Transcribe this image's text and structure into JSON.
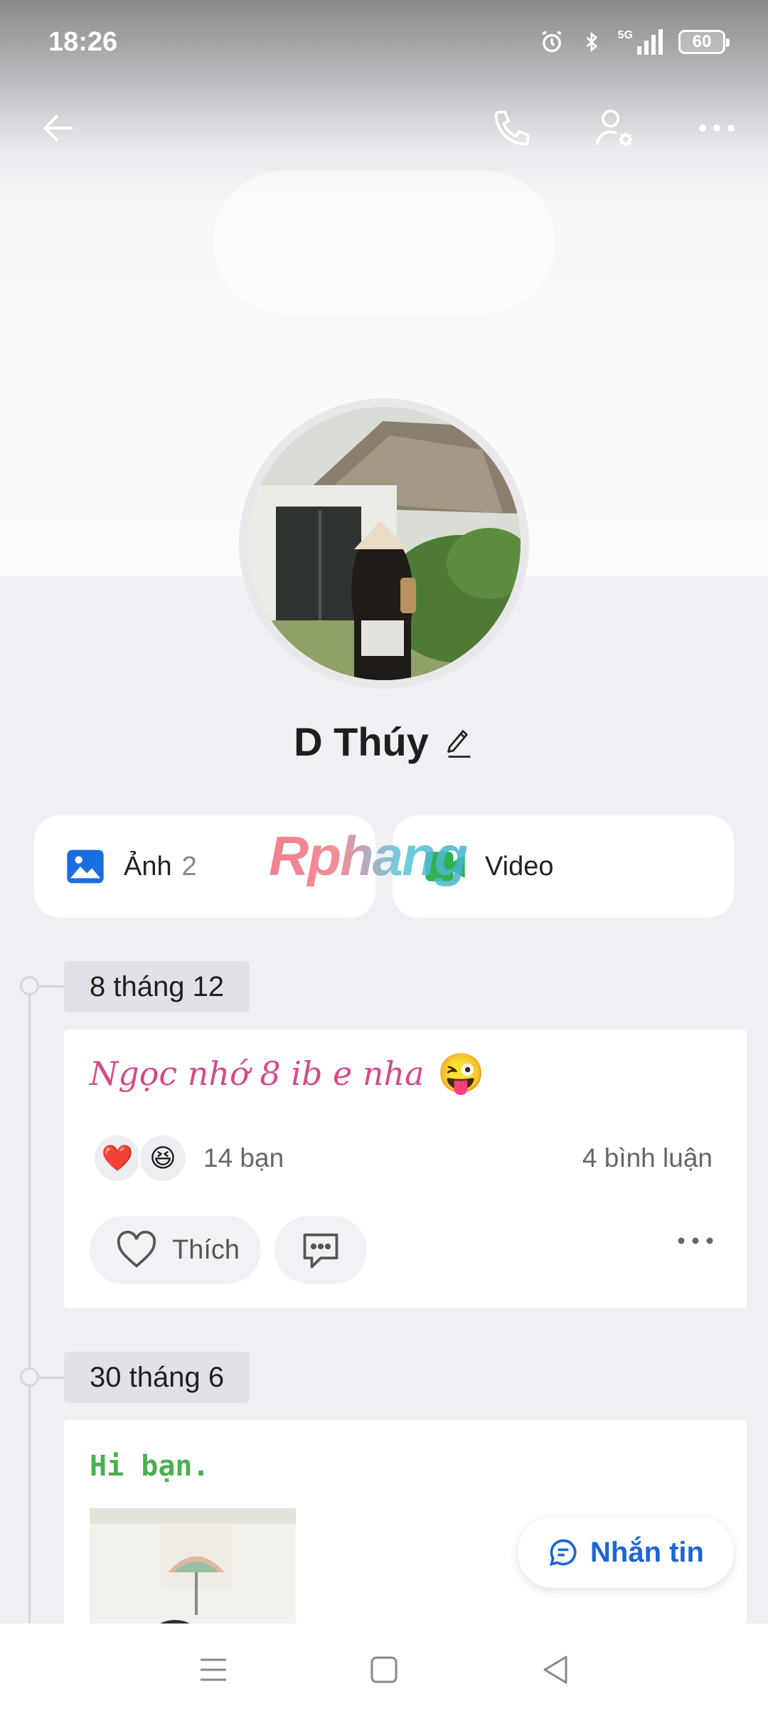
{
  "status_bar": {
    "time": "18:26",
    "network": "5G",
    "battery": "60"
  },
  "profile": {
    "name": "D Thúy"
  },
  "media": {
    "photos": {
      "label": "Ảnh",
      "count": "2"
    },
    "videos": {
      "label": "Video"
    }
  },
  "watermark": "Rphang",
  "posts": [
    {
      "date": "8 tháng 12",
      "text": "Ngọc nhớ 8 ib e nha",
      "emoji": "😜",
      "reactions": [
        "❤️",
        "😆"
      ],
      "reaction_count": "14 bạn",
      "comment_count": "4 bình luận",
      "like_label": "Thích"
    },
    {
      "date": "30 tháng 6",
      "text": "Hi bạn."
    }
  ],
  "message_button": {
    "label": "Nhắn tin"
  },
  "colors": {
    "accent_blue": "#1a66d8",
    "pink_text": "#d64a8a",
    "green_text": "#4caf50",
    "background": "#eff0f4"
  },
  "icons": [
    "back-arrow-icon",
    "phone-icon",
    "user-settings-icon",
    "more-icon",
    "edit-pencil-icon",
    "image-icon",
    "video-icon",
    "heart-icon",
    "comment-icon",
    "chat-bubble-icon",
    "menu-icon",
    "home-icon",
    "back-icon"
  ]
}
